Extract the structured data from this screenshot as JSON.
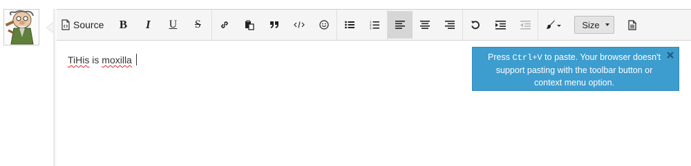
{
  "toolbar": {
    "source_label": "Source",
    "bold_label": "B",
    "italic_label": "I",
    "underline_label": "U",
    "strike_label": "S",
    "size_label": "Size"
  },
  "editor": {
    "content_words": [
      "TiHis",
      "is",
      "moxilla"
    ]
  },
  "notification": {
    "pre": "Press ",
    "shortcut": "Ctrl+V",
    "post": " to paste. Your browser doesn't support pasting with the toolbar button or context menu option."
  },
  "colors": {
    "notification_bg": "#3d9dcf",
    "toolbar_bg": "#f5f5f5",
    "active_button_bg": "#d6d6d6"
  },
  "icons": [
    "source-icon",
    "link-icon",
    "paste-icon",
    "quote-icon",
    "code-icon",
    "smiley-icon",
    "bullet-list-icon",
    "numbered-list-icon",
    "align-left-icon",
    "align-center-icon",
    "align-right-icon",
    "undo-icon",
    "indent-icon",
    "outdent-icon",
    "brush-icon",
    "document-icon",
    "close-icon"
  ]
}
